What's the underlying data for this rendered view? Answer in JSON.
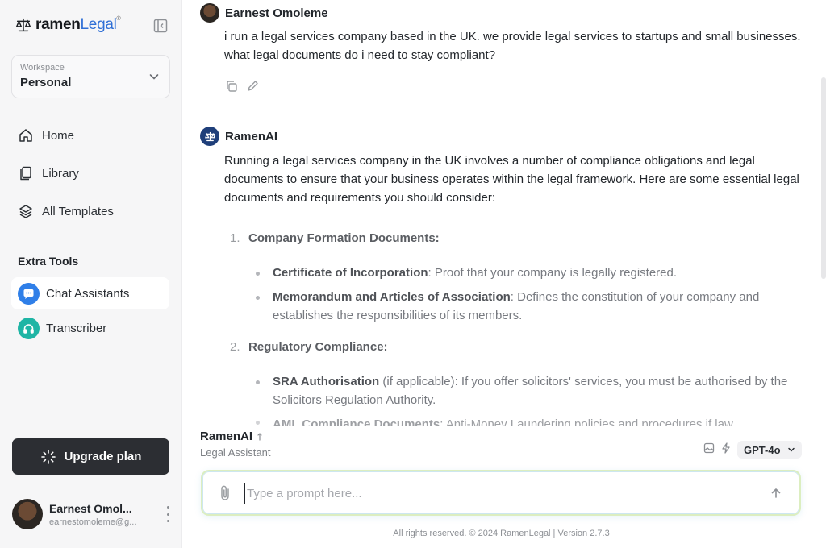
{
  "brand": {
    "name_bold": "ramen",
    "name_light": "Legal",
    "mark": "®"
  },
  "workspace": {
    "label": "Workspace",
    "value": "Personal"
  },
  "nav": [
    {
      "label": "Home",
      "icon": "home-icon"
    },
    {
      "label": "Library",
      "icon": "library-icon"
    },
    {
      "label": "All Templates",
      "icon": "layers-icon"
    }
  ],
  "extra_tools": {
    "title": "Extra Tools",
    "items": [
      {
        "label": "Chat Assistants",
        "icon": "chat-bubble-icon",
        "color": "#2f7fe8",
        "active": true
      },
      {
        "label": "Transcriber",
        "icon": "headphones-icon",
        "color": "#1fb5a5",
        "active": false
      }
    ]
  },
  "upgrade": {
    "label": "Upgrade plan"
  },
  "user": {
    "name": "Earnest Omol...",
    "email": "earnestomoleme@g..."
  },
  "conversation": {
    "user_message": {
      "author": "Earnest Omoleme",
      "text": "i run a legal services company based in the UK. we provide legal services to startups and small businesses. what legal documents do i need to stay compliant?"
    },
    "ai_message": {
      "author": "RamenAI",
      "intro": "Running a legal services company in the UK involves a number of compliance obligations and legal documents to ensure that your business operates within the legal framework. Here are some essential legal documents and requirements you should consider:",
      "sections": [
        {
          "number": "1.",
          "heading": "Company Formation Documents:",
          "bullets": [
            {
              "term": "Certificate of Incorporation",
              "text": ": Proof that your company is legally registered."
            },
            {
              "term": "Memorandum and Articles of Association",
              "text": ": Defines the constitution of your company and establishes the responsibilities of its members."
            }
          ]
        },
        {
          "number": "2.",
          "heading": "Regulatory Compliance:",
          "bullets": [
            {
              "term": "SRA Authorisation",
              "text": " (if applicable): If you offer solicitors' services, you must be authorised by the Solicitors Regulation Authority."
            },
            {
              "term": "AML Compliance Documents",
              "text": ": Anti-Money Laundering policies and procedures if law"
            }
          ]
        }
      ]
    }
  },
  "composer": {
    "assistant_name": "RamenAI",
    "assistant_role": "Legal Assistant",
    "model": "GPT-4o",
    "placeholder": "Type a prompt here..."
  },
  "footer": "All rights reserved. © 2024 RamenLegal | Version 2.7.3"
}
